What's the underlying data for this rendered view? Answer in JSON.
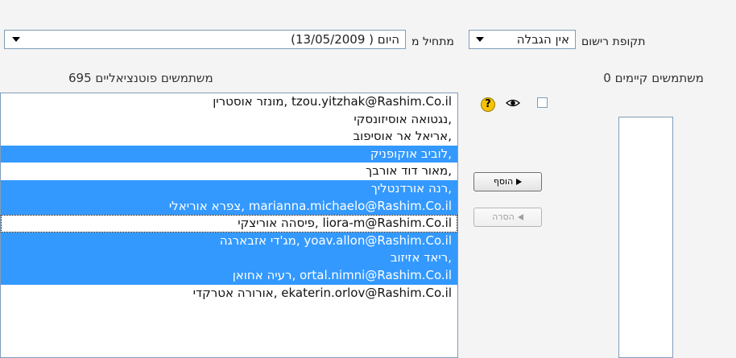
{
  "enrol": {
    "period_label": "תקופת רישום",
    "period_value": "אין הגבלה",
    "start_label": "מתחיל מ",
    "start_value": "היום ( 13/05/2009)"
  },
  "counts": {
    "existing": "0 משתמשים קיימים",
    "potential": "695 משתמשים פוטנציאליים"
  },
  "potential_users": [
    {
      "text": "מונזר אוסטרין, tzou.yitzhak@Rashim.Co.il",
      "selected": false,
      "focused": false
    },
    {
      "text": "נגטואה אוסיזונסקי,",
      "selected": false,
      "focused": false
    },
    {
      "text": "אריאל אר אוסיפוב,",
      "selected": false,
      "focused": false
    },
    {
      "text": "לוביב אוקופניק,",
      "selected": true,
      "focused": false
    },
    {
      "text": "מאור דוד אורבך,",
      "selected": false,
      "focused": false
    },
    {
      "text": "רנה אורדנטליך,",
      "selected": true,
      "focused": false
    },
    {
      "text": "צפרא אוריאלי, marianna.michaelo@Rashim.Co.il",
      "selected": true,
      "focused": false
    },
    {
      "text": "פיסהה אוריצקי, liora-m@Rashim.Co.il",
      "selected": false,
      "focused": true
    },
    {
      "text": "מג'די אזבארגה, yoav.allon@Rashim.Co.il",
      "selected": true,
      "focused": false
    },
    {
      "text": "ריאד אזיזוב,",
      "selected": true,
      "focused": false
    },
    {
      "text": "רעיה אחואן, ortal.nimni@Rashim.Co.il",
      "selected": true,
      "focused": false
    },
    {
      "text": "אורורה אטרקדי, ekaterin.orlov@Rashim.Co.il",
      "selected": false,
      "focused": false
    }
  ],
  "buttons": {
    "add": "הוסף",
    "remove": "הסרה"
  },
  "icons": {
    "eye": "eye-icon",
    "help": "help-icon",
    "help_glyph": "?"
  },
  "colors": {
    "selection": "#3399ff",
    "help_bg": "#f6c400"
  }
}
